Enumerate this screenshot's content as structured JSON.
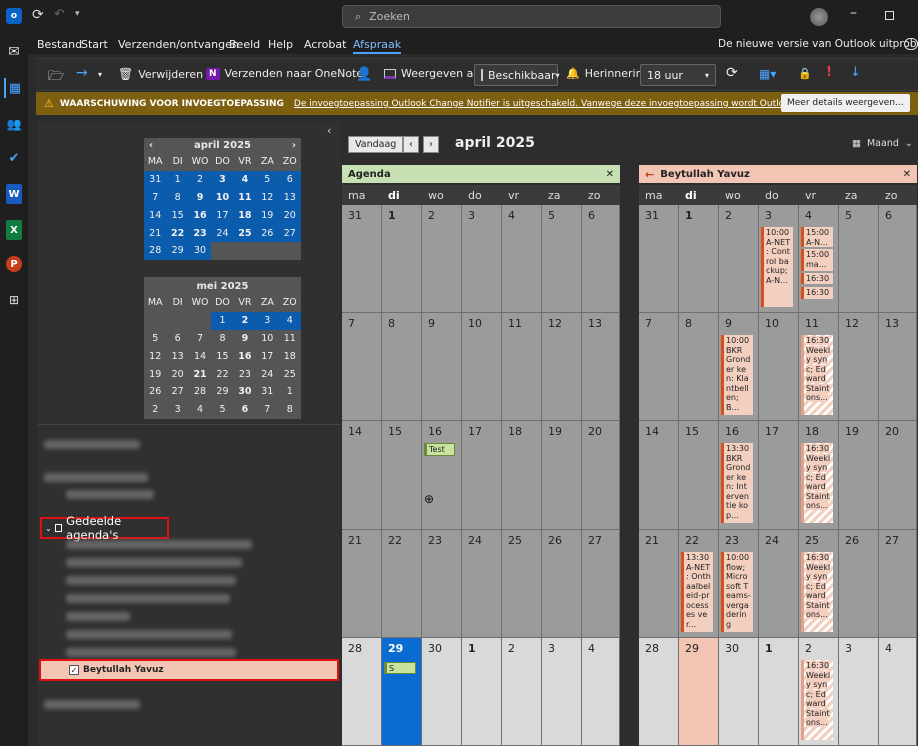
{
  "titlebar": {
    "search_placeholder": "Zoeken"
  },
  "ribbon": {
    "tabs": [
      "Bestand",
      "Start",
      "Verzenden/ontvangen",
      "Beeld",
      "Help",
      "Acrobat",
      "Afspraak"
    ],
    "active_tab": "Afspraak",
    "new_outlook": "De nieuwe versie van Outlook uitproberen"
  },
  "toolbar": {
    "delete": "Verwijderen",
    "onenote": "Verzenden naar OneNote",
    "show_as_label": "Weergeven als:",
    "show_as_value": "Beschikbaar",
    "reminder_label": "Herinnering:",
    "reminder_value": "18 uur"
  },
  "warning": {
    "title": "WAARSCHUWING VOOR INVOEGTOEPASSING",
    "message": "De invoegtoepassing Outlook Change Notifier is uitgeschakeld. Vanwege deze invoegtoepassing wordt Outlook langzaam gesloten.",
    "button": "Meer details weergeven..."
  },
  "mini_april": {
    "title": "april 2025",
    "dow": [
      "MA",
      "DI",
      "WO",
      "DO",
      "VR",
      "ZA",
      "ZO"
    ],
    "weeks": [
      [
        "31",
        "1",
        "2",
        "3",
        "4",
        "5",
        "6"
      ],
      [
        "7",
        "8",
        "9",
        "10",
        "11",
        "12",
        "13"
      ],
      [
        "14",
        "15",
        "16",
        "17",
        "18",
        "19",
        "20"
      ],
      [
        "21",
        "22",
        "23",
        "24",
        "25",
        "26",
        "27"
      ],
      [
        "28",
        "29",
        "30",
        "",
        "",
        "",
        ""
      ]
    ]
  },
  "mini_may": {
    "title": "mei 2025",
    "dow": [
      "MA",
      "DI",
      "WO",
      "DO",
      "VR",
      "ZA",
      "ZO"
    ],
    "weeks": [
      [
        "",
        "",
        "",
        "1",
        "2",
        "3",
        "4"
      ],
      [
        "5",
        "6",
        "7",
        "8",
        "9",
        "10",
        "11"
      ],
      [
        "12",
        "13",
        "14",
        "15",
        "16",
        "17",
        "18"
      ],
      [
        "19",
        "20",
        "21",
        "22",
        "23",
        "24",
        "25"
      ],
      [
        "26",
        "27",
        "28",
        "29",
        "30",
        "31",
        "1"
      ],
      [
        "2",
        "3",
        "4",
        "5",
        "6",
        "7",
        "8"
      ]
    ]
  },
  "folders": {
    "shared_title": "Gedeelde agenda's",
    "checked_item": "Beytullah Yavuz"
  },
  "cal": {
    "today_btn": "Vandaag",
    "title": "april 2025",
    "view": "Maand",
    "left_name": "Agenda",
    "right_name": "Beytullah Yavuz",
    "dow": [
      "ma",
      "di",
      "wo",
      "do",
      "vr",
      "za",
      "zo"
    ],
    "weeks": [
      [
        "31",
        "1",
        "2",
        "3",
        "4",
        "5",
        "6"
      ],
      [
        "7",
        "8",
        "9",
        "10",
        "11",
        "12",
        "13"
      ],
      [
        "14",
        "15",
        "16",
        "17",
        "18",
        "19",
        "20"
      ],
      [
        "21",
        "22",
        "23",
        "24",
        "25",
        "26",
        "27"
      ],
      [
        "28",
        "29",
        "30",
        "1",
        "2",
        "3",
        "4"
      ]
    ],
    "left_events": {
      "test": "Test",
      "s": "S"
    },
    "right_events": {
      "e1": "10:00 A-NET : Control backup; A-N...",
      "e2": "15:00 A-N...",
      "e3": "15:00 ma...",
      "e4": "16:30",
      "e5": "16:30",
      "e6": "10:00 BKR Gronder ken: Klantbellen; B...",
      "e7": "16:30 Weekly sync; Edward Staintons...",
      "e8": "13:30 BKR Gronder ken: Interventie kop...",
      "e9": "16:30 Weekly sync; Edward Staintons...",
      "e10": "13:30 A-NET : Onthaalbeleid-processes ver...",
      "e11": "10:00 flow; Microsoft Teams-vergadering",
      "e12": "16:30 Weekly sync; Edward Staintons...",
      "e13": "16:30 Weekly sync; Edward Staintons..."
    }
  }
}
